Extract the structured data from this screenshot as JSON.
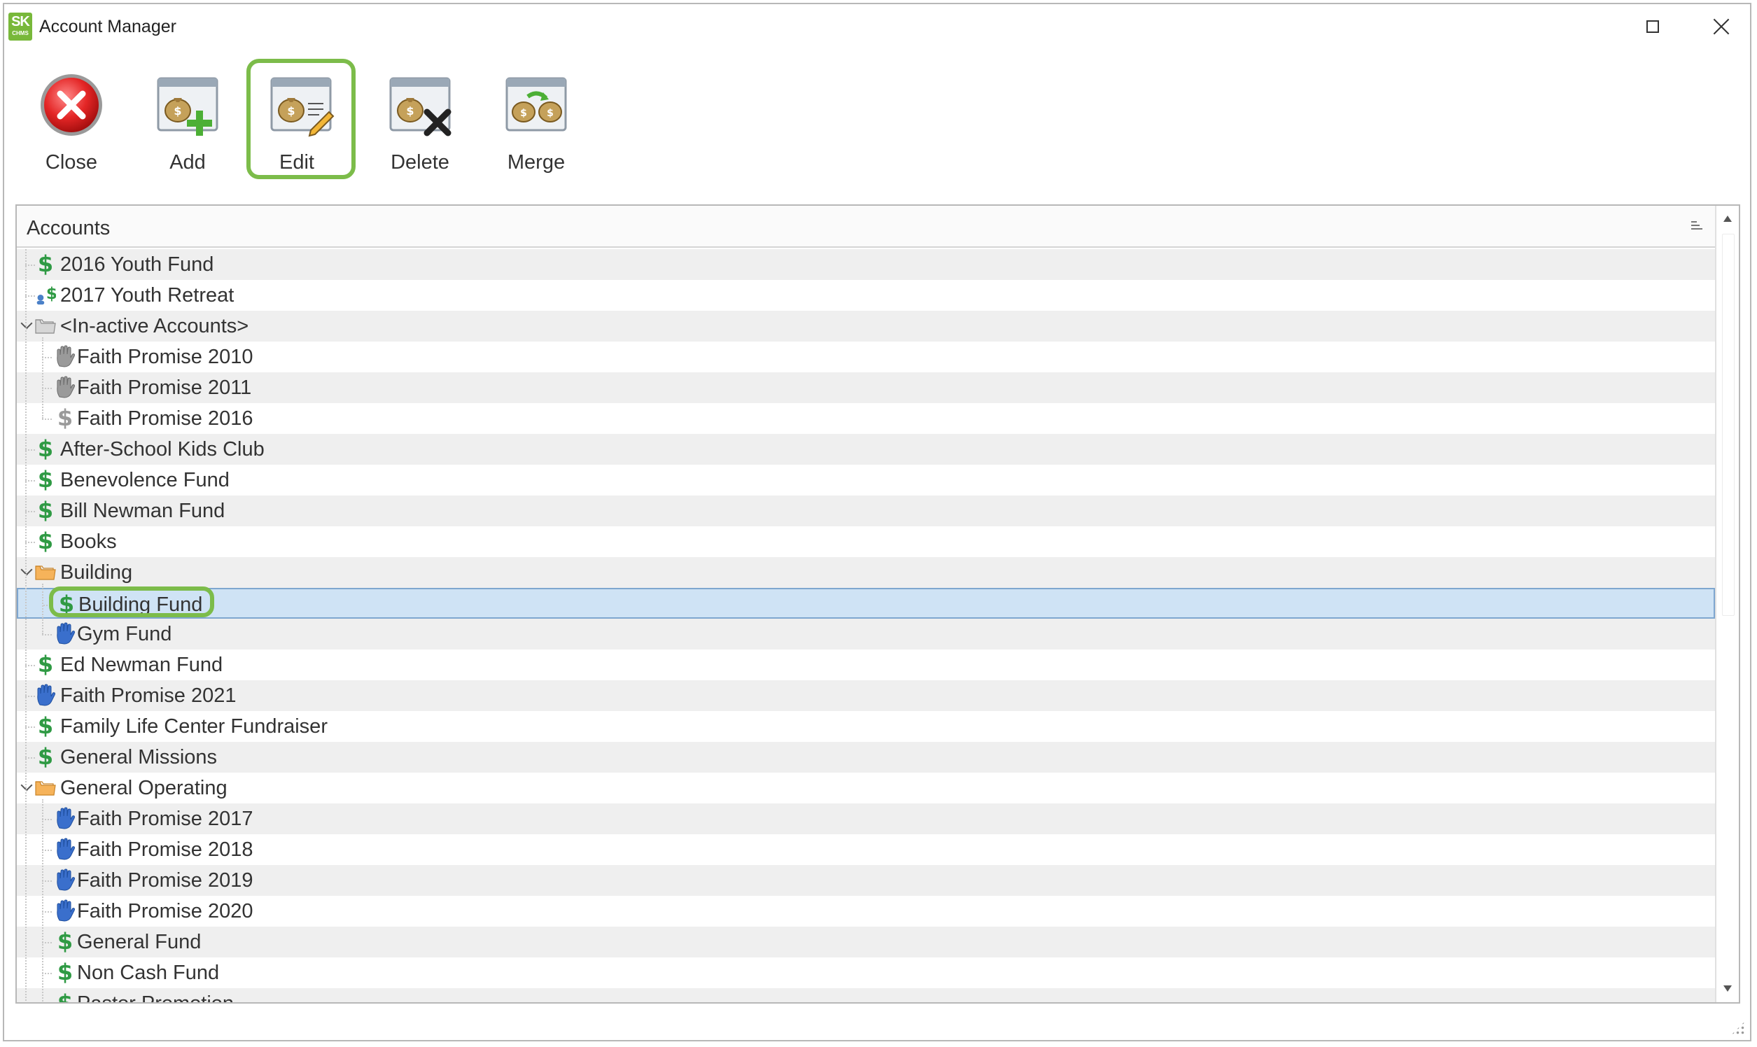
{
  "window": {
    "title": "Account Manager",
    "logo_text": "SK",
    "logo_subtext": "CHMS"
  },
  "toolbar": {
    "buttons": [
      {
        "label": "Close",
        "icon": "close-circle-icon"
      },
      {
        "label": "Add",
        "icon": "money-bag-add-icon"
      },
      {
        "label": "Edit",
        "icon": "money-bag-edit-icon"
      },
      {
        "label": "Delete",
        "icon": "money-bag-delete-icon"
      },
      {
        "label": "Merge",
        "icon": "money-bag-merge-icon"
      }
    ],
    "highlighted": "Edit"
  },
  "panel": {
    "header": "Accounts"
  },
  "tree": {
    "rows": [
      {
        "label": "2016 Youth Fund",
        "level": 0,
        "icon": "dollar-icon",
        "icon_color": "#2f9a44"
      },
      {
        "label": "2017 Youth Retreat",
        "level": 0,
        "icon": "dollar-person-icon",
        "icon_color": "#2f9a44"
      },
      {
        "label": "<In-active Accounts>",
        "level": 0,
        "icon": "folder-gray-icon",
        "expanded": true
      },
      {
        "label": "Faith Promise 2010",
        "level": 1,
        "icon": "hand-gray-icon"
      },
      {
        "label": "Faith Promise 2011",
        "level": 1,
        "icon": "hand-gray-icon"
      },
      {
        "label": "Faith Promise 2016",
        "level": 1,
        "icon": "dollar-gray-icon",
        "icon_color": "#9a9a9a"
      },
      {
        "label": "After-School Kids Club",
        "level": 0,
        "icon": "dollar-icon",
        "icon_color": "#2f9a44"
      },
      {
        "label": "Benevolence Fund",
        "level": 0,
        "icon": "dollar-icon",
        "icon_color": "#2f9a44"
      },
      {
        "label": "Bill Newman Fund",
        "level": 0,
        "icon": "dollar-icon",
        "icon_color": "#2f9a44"
      },
      {
        "label": "Books",
        "level": 0,
        "icon": "dollar-icon",
        "icon_color": "#2f9a44"
      },
      {
        "label": "Building",
        "level": 0,
        "icon": "folder-orange-icon",
        "expanded": true
      },
      {
        "label": "Building Fund",
        "level": 1,
        "icon": "dollar-icon",
        "icon_color": "#2f9a44",
        "selected": true
      },
      {
        "label": "Gym Fund",
        "level": 1,
        "icon": "hand-blue-icon"
      },
      {
        "label": "Ed Newman Fund",
        "level": 0,
        "icon": "dollar-icon",
        "icon_color": "#2f9a44"
      },
      {
        "label": "Faith Promise 2021",
        "level": 0,
        "icon": "hand-blue-icon"
      },
      {
        "label": "Family Life Center Fundraiser",
        "level": 0,
        "icon": "dollar-icon",
        "icon_color": "#2f9a44"
      },
      {
        "label": "General Missions",
        "level": 0,
        "icon": "dollar-icon",
        "icon_color": "#2f9a44"
      },
      {
        "label": "General Operating",
        "level": 0,
        "icon": "folder-orange-icon",
        "expanded": true
      },
      {
        "label": "Faith Promise 2017",
        "level": 1,
        "icon": "hand-blue-icon"
      },
      {
        "label": "Faith Promise 2018",
        "level": 1,
        "icon": "hand-blue-icon"
      },
      {
        "label": "Faith Promise 2019",
        "level": 1,
        "icon": "hand-blue-icon"
      },
      {
        "label": "Faith Promise 2020",
        "level": 1,
        "icon": "hand-blue-icon"
      },
      {
        "label": "General Fund",
        "level": 1,
        "icon": "dollar-icon",
        "icon_color": "#2f9a44"
      },
      {
        "label": "Non Cash Fund",
        "level": 1,
        "icon": "dollar-icon",
        "icon_color": "#2f9a44"
      },
      {
        "label": "Pastor Promotion",
        "level": 1,
        "icon": "dollar-icon",
        "icon_color": "#2f9a44",
        "clipped": true
      }
    ]
  },
  "colors": {
    "highlight": "#7cbc4a",
    "selection_bg": "#cfe3f5",
    "selection_border": "#7ea6cf",
    "alt_row": "#efefef"
  }
}
